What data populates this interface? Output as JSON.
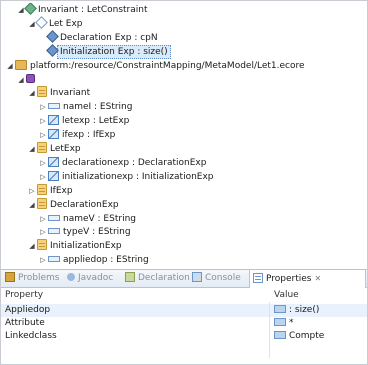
{
  "tree": [
    {
      "indent": 1,
      "twisty": "expanded",
      "icon": "constraint-diamond-icon",
      "label": "Invariant : LetConstraint"
    },
    {
      "indent": 2,
      "twisty": "expanded",
      "icon": "let-exp-diamond-icon",
      "label": "Let Exp"
    },
    {
      "indent": 3,
      "twisty": "none",
      "icon": "declaration-diamond-icon",
      "label": "Declaration Exp : cpN"
    },
    {
      "indent": 3,
      "twisty": "none",
      "icon": "initialization-diamond-icon",
      "label": "Initialization Exp : size()",
      "selected": true
    },
    {
      "indent": 0,
      "twisty": "expanded",
      "icon": "resource-file-icon",
      "label": "platform:/resource/ConstraintMapping/MetaModel/Let1.ecore"
    },
    {
      "indent": 1,
      "twisty": "expanded",
      "icon": "package-icon",
      "label": ""
    },
    {
      "indent": 2,
      "twisty": "expanded",
      "icon": "eclass-icon",
      "label": "Invariant"
    },
    {
      "indent": 3,
      "twisty": "collapsed",
      "icon": "eattribute-icon",
      "label": "nameI : EString"
    },
    {
      "indent": 3,
      "twisty": "collapsed",
      "icon": "ereference-icon",
      "label": "letexp : LetExp"
    },
    {
      "indent": 3,
      "twisty": "collapsed",
      "icon": "ereference-icon",
      "label": "ifexp : IfExp"
    },
    {
      "indent": 2,
      "twisty": "expanded",
      "icon": "eclass-icon",
      "label": "LetExp"
    },
    {
      "indent": 3,
      "twisty": "collapsed",
      "icon": "ereference-icon",
      "label": "declarationexp : DeclarationExp"
    },
    {
      "indent": 3,
      "twisty": "collapsed",
      "icon": "ereference-icon",
      "label": "initializationexp : InitializationExp"
    },
    {
      "indent": 2,
      "twisty": "collapsed",
      "icon": "eclass-icon",
      "label": "IfExp"
    },
    {
      "indent": 2,
      "twisty": "expanded",
      "icon": "eclass-icon",
      "label": "DeclarationExp"
    },
    {
      "indent": 3,
      "twisty": "collapsed",
      "icon": "eattribute-icon",
      "label": "nameV : EString"
    },
    {
      "indent": 3,
      "twisty": "collapsed",
      "icon": "eattribute-icon",
      "label": "typeV : EString"
    },
    {
      "indent": 2,
      "twisty": "expanded",
      "icon": "eclass-icon",
      "label": "InitializationExp"
    },
    {
      "indent": 3,
      "twisty": "collapsed",
      "icon": "eattribute-icon",
      "label": "appliedop : EString"
    }
  ],
  "tabs": [
    {
      "label": "Problems",
      "icon": "problems-icon",
      "active": false
    },
    {
      "label": "Javadoc",
      "icon": "javadoc-icon",
      "active": false
    },
    {
      "label": "Declaration",
      "icon": "declaration-icon",
      "active": false
    },
    {
      "label": "Console",
      "icon": "console-icon",
      "active": false
    },
    {
      "label": "Properties",
      "icon": "properties-icon",
      "active": true,
      "close": "✕"
    }
  ],
  "properties": {
    "header_property": "Property",
    "header_value": "Value",
    "rows": [
      {
        "property": "Appliedop",
        "value": ": size()"
      },
      {
        "property": "Attribute",
        "value": "*"
      },
      {
        "property": "Linkedclass",
        "value": "Compte"
      }
    ]
  },
  "colors": {
    "accent": "#5b8fd1",
    "selection": "#d9ebfb",
    "row_alt": "#e8f1fc"
  }
}
